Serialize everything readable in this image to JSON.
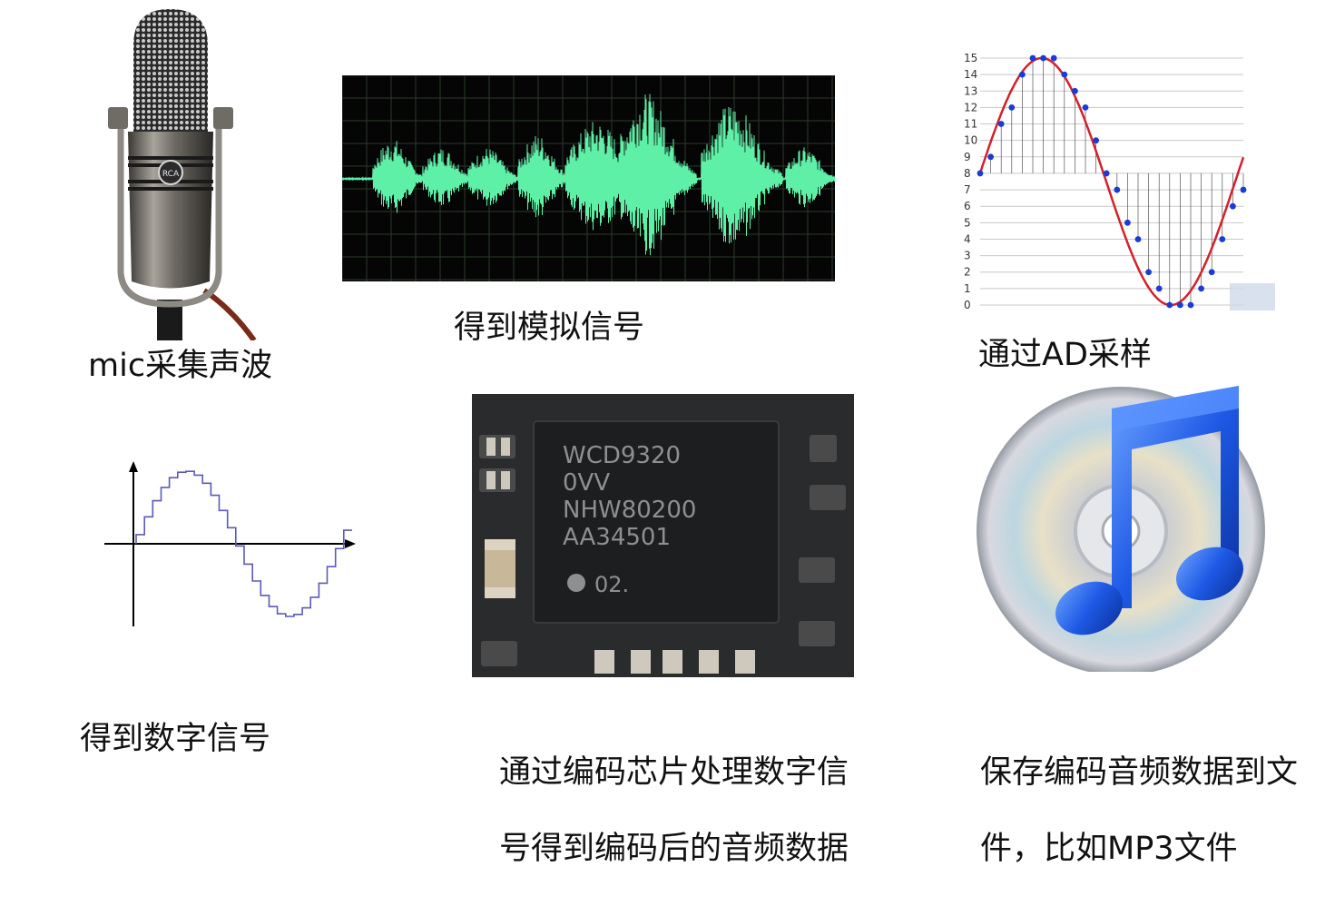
{
  "captions": {
    "mic": "mic采集声波",
    "analog": "得到模拟信号",
    "sampling": "通过AD采样",
    "digital": "得到数字信号",
    "codec_line1": "通过编码芯片处理数字信",
    "codec_line2": "号得到编码后的音频数据",
    "save_line1": "保存编码音频数据到文",
    "save_line2": "件，比如MP3文件"
  },
  "mic": {
    "badge": "RCA"
  },
  "chip": {
    "lines": [
      "WCD9320",
      "0VV",
      "NHW80200",
      "AA34501"
    ],
    "mark": "02."
  },
  "sampling_chart": {
    "y_ticks": [
      "15",
      "14",
      "13",
      "12",
      "11",
      "10",
      "9",
      "8",
      "7",
      "6",
      "5",
      "4",
      "3",
      "2",
      "1",
      "0"
    ]
  },
  "chart_data": {
    "type": "scatter",
    "title": "",
    "xlabel": "",
    "ylabel": "",
    "ylim": [
      0,
      15
    ],
    "series": [
      {
        "values": [
          8,
          9,
          11,
          12,
          14,
          15,
          15,
          15,
          14,
          13,
          12,
          10,
          8,
          7,
          5,
          4,
          2,
          1,
          0,
          0,
          0,
          1,
          2,
          4,
          6,
          7
        ]
      }
    ]
  },
  "colors": {
    "wave": "#5ff0a8",
    "wave_bg": "#050505",
    "sine": "#d4202a",
    "sample_dot": "#1a3bd6",
    "step_line": "#5a5ab8",
    "chip_body": "#1d1e20",
    "note_blue": "#1e5ae6"
  }
}
